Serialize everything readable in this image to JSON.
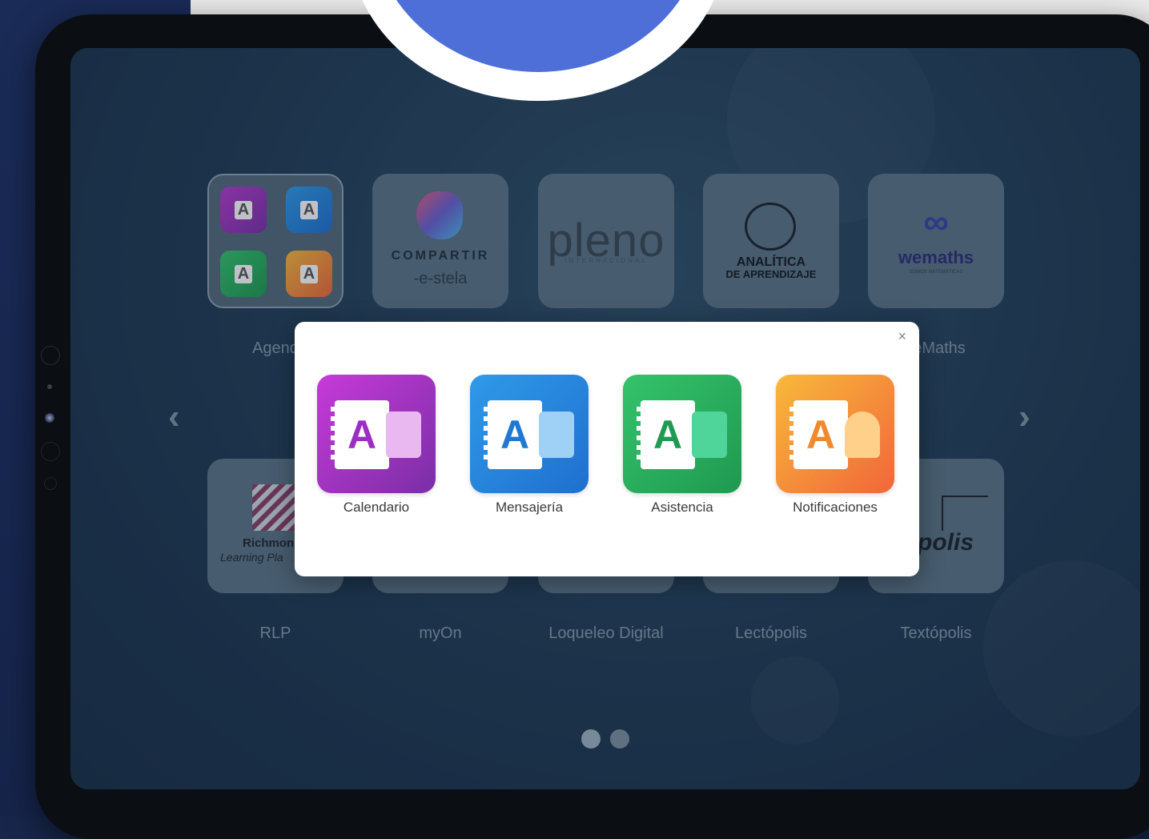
{
  "tiles_row1": [
    {
      "label": "Agenda",
      "visible_label": "Agend"
    },
    {
      "label": "",
      "logo_text": "COMPARTIR",
      "logo_sub": "-e-stela"
    },
    {
      "label": "",
      "logo_text": "pleno",
      "logo_sub": "INTERNACIONAL"
    },
    {
      "label": "",
      "logo_text": "ANALÍTICA",
      "logo_sub": "DE APRENDIZAJE"
    },
    {
      "label": "eMaths",
      "logo_text": "wemaths",
      "logo_sub": "SOMOS MATEMÁTICAS"
    }
  ],
  "tiles_row2": [
    {
      "label": "RLP",
      "logo_text": "Richmon",
      "logo_sub": "Learning Pla"
    },
    {
      "label": "myOn"
    },
    {
      "label": "Loqueleo Digital"
    },
    {
      "label": "Lectópolis"
    },
    {
      "label": "Textópolis",
      "logo_text": "polis"
    }
  ],
  "agenda_mini_letter": "A",
  "nav": {
    "prev": "‹",
    "next": "›"
  },
  "pagination": {
    "total": 2,
    "active": 1
  },
  "modal": {
    "close": "×",
    "apps": [
      {
        "label": "Calendario",
        "letter": "A",
        "icon": "calendar-icon",
        "color_a": "#c73ad9",
        "color_b": "#7a2ea6",
        "letter_color": "#9b2fc4"
      },
      {
        "label": "Mensajería",
        "letter": "A",
        "icon": "mail-icon",
        "color_a": "#2f9ae8",
        "color_b": "#1f6fcf",
        "letter_color": "#1f78d2"
      },
      {
        "label": "Asistencia",
        "letter": "A",
        "icon": "checklist-icon",
        "color_a": "#34c36b",
        "color_b": "#1f9950",
        "letter_color": "#1f9a52"
      },
      {
        "label": "Notificaciones",
        "letter": "A",
        "icon": "bell-icon",
        "color_a": "#f8b93a",
        "color_b": "#f1663a",
        "letter_color": "#f08a2e"
      }
    ]
  }
}
